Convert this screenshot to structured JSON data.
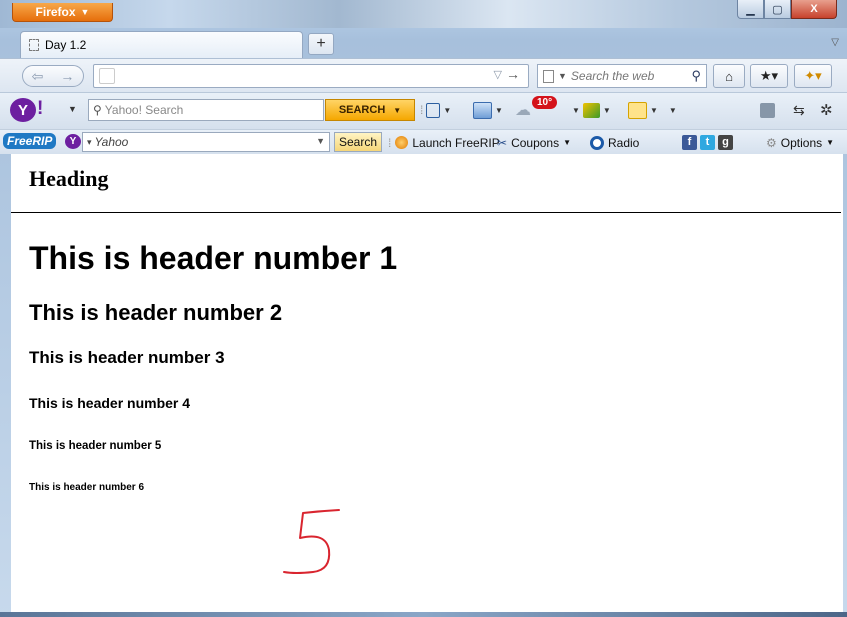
{
  "window": {
    "app_button_label": "Firefox",
    "min_icon": "minimize-icon",
    "max_icon": "maximize-icon",
    "close_label": "X"
  },
  "tabs": [
    {
      "label": "Day 1.2",
      "active": true
    }
  ],
  "new_tab_label": "+",
  "navbar": {
    "url_value": "",
    "search_placeholder": "Search the web"
  },
  "yahoo_toolbar": {
    "logo_text": "Y",
    "bang": "!",
    "search_placeholder": "Yahoo! Search",
    "search_button_label": "SEARCH",
    "weather_badge": "10°"
  },
  "freerip_toolbar": {
    "logo_text": "FreeRIP",
    "search_engine_label": "Yahoo",
    "search_button_label": "Search",
    "launch_label": "Launch FreeRIP",
    "coupons_label": "Coupons",
    "radio_label": "Radio",
    "options_label": "Options"
  },
  "page": {
    "heading": "Heading",
    "headers": [
      "This is header number 1",
      "This is header number 2",
      "This is header number 3",
      "This is header number 4",
      "This is header number 5",
      "This is header number 6"
    ],
    "annotation_color": "#d9252f"
  },
  "colors": {
    "firefox_orange": "#e66e0b",
    "yahoo_purple": "#6d1fa0",
    "freerip_blue": "#1f79c4"
  }
}
